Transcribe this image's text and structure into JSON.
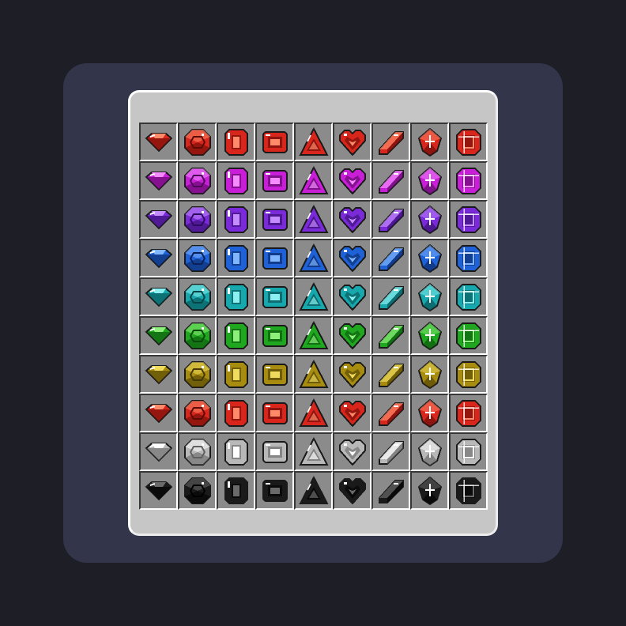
{
  "inventory": {
    "gem_shapes": [
      "trillion-gem-icon",
      "round-gem-icon",
      "emerald-cut-gem-icon",
      "cushion-gem-icon",
      "triangle-gem-icon",
      "heart-gem-icon",
      "bar-gem-icon",
      "kite-gem-icon",
      "octagon-gem-icon"
    ],
    "gem_colors": [
      {
        "name": "red",
        "base": "#d8261c",
        "light": "#ff8a6a",
        "dark": "#5e0a06"
      },
      {
        "name": "magenta",
        "base": "#c81ed8",
        "light": "#f48cff",
        "dark": "#4e0858"
      },
      {
        "name": "violet",
        "base": "#7a2ad8",
        "light": "#c48cff",
        "dark": "#2e0c62"
      },
      {
        "name": "blue",
        "base": "#1f62d8",
        "light": "#7fb6ff",
        "dark": "#0a2258"
      },
      {
        "name": "cyan",
        "base": "#17a8ae",
        "light": "#8cf0f0",
        "dark": "#064648"
      },
      {
        "name": "green",
        "base": "#1fa81f",
        "light": "#8cf07a",
        "dark": "#0a4a0a"
      },
      {
        "name": "gold",
        "base": "#a88c10",
        "light": "#f0dc5c",
        "dark": "#463a04"
      },
      {
        "name": "red",
        "base": "#d8261c",
        "light": "#ff8a6a",
        "dark": "#5e0a06"
      },
      {
        "name": "white",
        "base": "#b8b8b8",
        "light": "#ffffff",
        "dark": "#606060"
      },
      {
        "name": "black",
        "base": "#1a1a1a",
        "light": "#6a6a6a",
        "dark": "#000000"
      }
    ]
  }
}
